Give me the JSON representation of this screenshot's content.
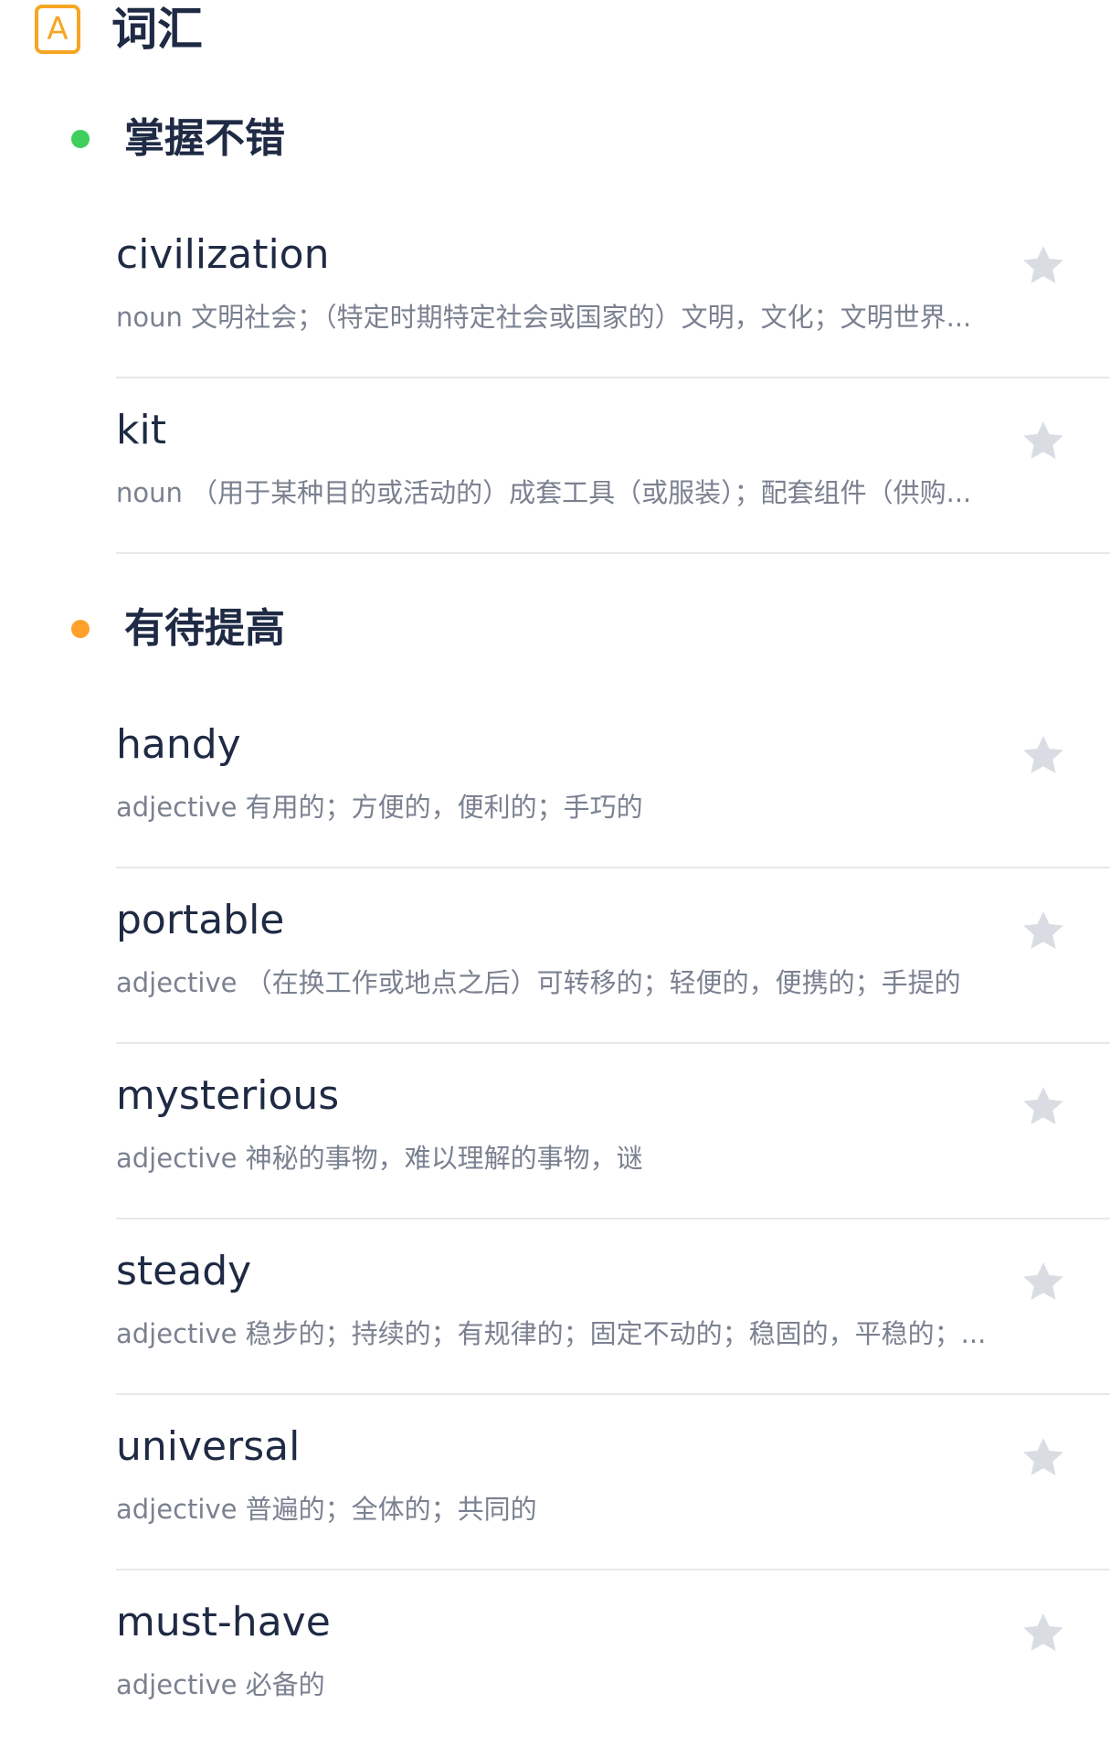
{
  "header": {
    "badge_letter": "A",
    "title": "词汇"
  },
  "colors": {
    "accent": "#f5a623",
    "good": "#3ecf5c",
    "improve": "#ffa12b",
    "star": "#d9dde3",
    "text": "#1f2a44",
    "muted": "#7a8190"
  },
  "sections": [
    {
      "title": "掌握不错",
      "words": [
        {
          "word": "civilization",
          "definition": "noun 文明社会；（特定时期特定社会或国家的）文明，文化；文明世界..."
        },
        {
          "word": "kit",
          "definition": "noun （用于某种目的或活动的）成套工具（或服装）；配套组件（供购..."
        }
      ]
    },
    {
      "title": "有待提高",
      "words": [
        {
          "word": "handy",
          "definition": "adjective 有用的；方便的，便利的；手巧的"
        },
        {
          "word": "portable",
          "definition": "adjective （在换工作或地点之后）可转移的；轻便的，便携的；手提的"
        },
        {
          "word": "mysterious",
          "definition": "adjective 神秘的事物，难以理解的事物，谜"
        },
        {
          "word": "steady",
          "definition": "adjective 稳步的；持续的；有规律的；固定不动的；稳固的，平稳的；..."
        },
        {
          "word": "universal",
          "definition": "adjective 普遍的；全体的；共同的"
        },
        {
          "word": "must-have",
          "definition": "adjective 必备的"
        }
      ]
    }
  ]
}
